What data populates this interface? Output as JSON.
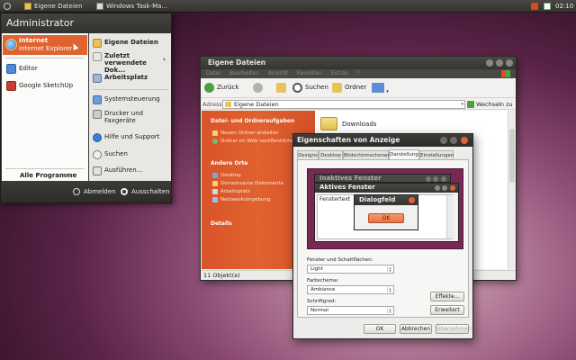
{
  "taskbar": {
    "tasks": [
      {
        "label": "Eigene Dateien"
      },
      {
        "label": "Windows Task-Ma..."
      }
    ],
    "clock": "02:10"
  },
  "startmenu": {
    "header": "Administrator",
    "left_items": [
      {
        "title": "Internet",
        "subtitle": "Internet Explorer",
        "icon": "internet-explorer-icon"
      },
      {
        "title": "Editor",
        "icon": "notepad-icon"
      },
      {
        "title": "Google SketchUp",
        "icon": "sketchup-icon"
      }
    ],
    "all_programs": "Alle Programme",
    "right_items": [
      {
        "label": "Eigene Dateien",
        "bold": true,
        "icon": "folder-icon"
      },
      {
        "label": "Zuletzt verwendete Dok...",
        "bold": true,
        "icon": "recent-documents-icon"
      },
      {
        "label": "Arbeitsplatz",
        "bold": true,
        "icon": "computer-icon"
      },
      {
        "label": "Systemsteuerung",
        "bold": false,
        "icon": "control-panel-icon"
      },
      {
        "label": "Drucker und Faxgeräte",
        "bold": false,
        "icon": "printer-icon"
      },
      {
        "label": "Hilfe und Support",
        "bold": false,
        "icon": "help-icon"
      },
      {
        "label": "Suchen",
        "bold": false,
        "icon": "search-icon"
      },
      {
        "label": "Ausführen...",
        "bold": false,
        "icon": "run-icon"
      }
    ],
    "logout": "Abmelden",
    "shutdown": "Ausschalten"
  },
  "explorer": {
    "title": "Eigene Dateien",
    "menu": [
      "Datei",
      "Bearbeiten",
      "Ansicht",
      "Favoriten",
      "Extras",
      "?"
    ],
    "back": "Zurück",
    "search": "Suchen",
    "folders": "Ordner",
    "address_label": "Adresse",
    "address_value": "Eigene Dateien",
    "go": "Wechseln zu",
    "tasks_header": "Datei- und Ordneraufgaben",
    "tasks": [
      "Neuen Ordner erstellen",
      "Ordner im Web veröffentlichen"
    ],
    "places_header": "Andere Orte",
    "places": [
      "Desktop",
      "Gemeinsame Dokumente",
      "Arbeitsplatz",
      "Netzwerkumgebung"
    ],
    "details_header": "Details",
    "content_items": [
      {
        "label": "Downloads"
      }
    ],
    "status": "11 Objekt(e)"
  },
  "dialog": {
    "title": "Eigenschaften von Anzeige",
    "tabs": [
      "Designs",
      "Desktop",
      "Bildschirmschoner",
      "Darstellung",
      "Einstellungen"
    ],
    "active_tab": "Darstellung",
    "preview": {
      "inactive_title": "Inaktives Fenster",
      "active_title": "Aktives Fenster",
      "window_text": "Fenstertext",
      "msgbox_title": "Dialogfeld",
      "ok": "OK"
    },
    "windows_label": "Fenster und Schaltflächen:",
    "windows_value": "Light",
    "scheme_label": "Farbschema:",
    "scheme_value": "Ambiance",
    "fontsize_label": "Schriftgrad:",
    "fontsize_value": "Normal",
    "effects": "Effekte...",
    "advanced": "Erweitert",
    "ok": "OK",
    "cancel": "Abbrechen",
    "apply": "Übernehmen"
  },
  "colors": {
    "accent_orange": "#dd4814",
    "ubuntu_aubergine": "#772953",
    "panel_dark": "#3c3b37"
  }
}
